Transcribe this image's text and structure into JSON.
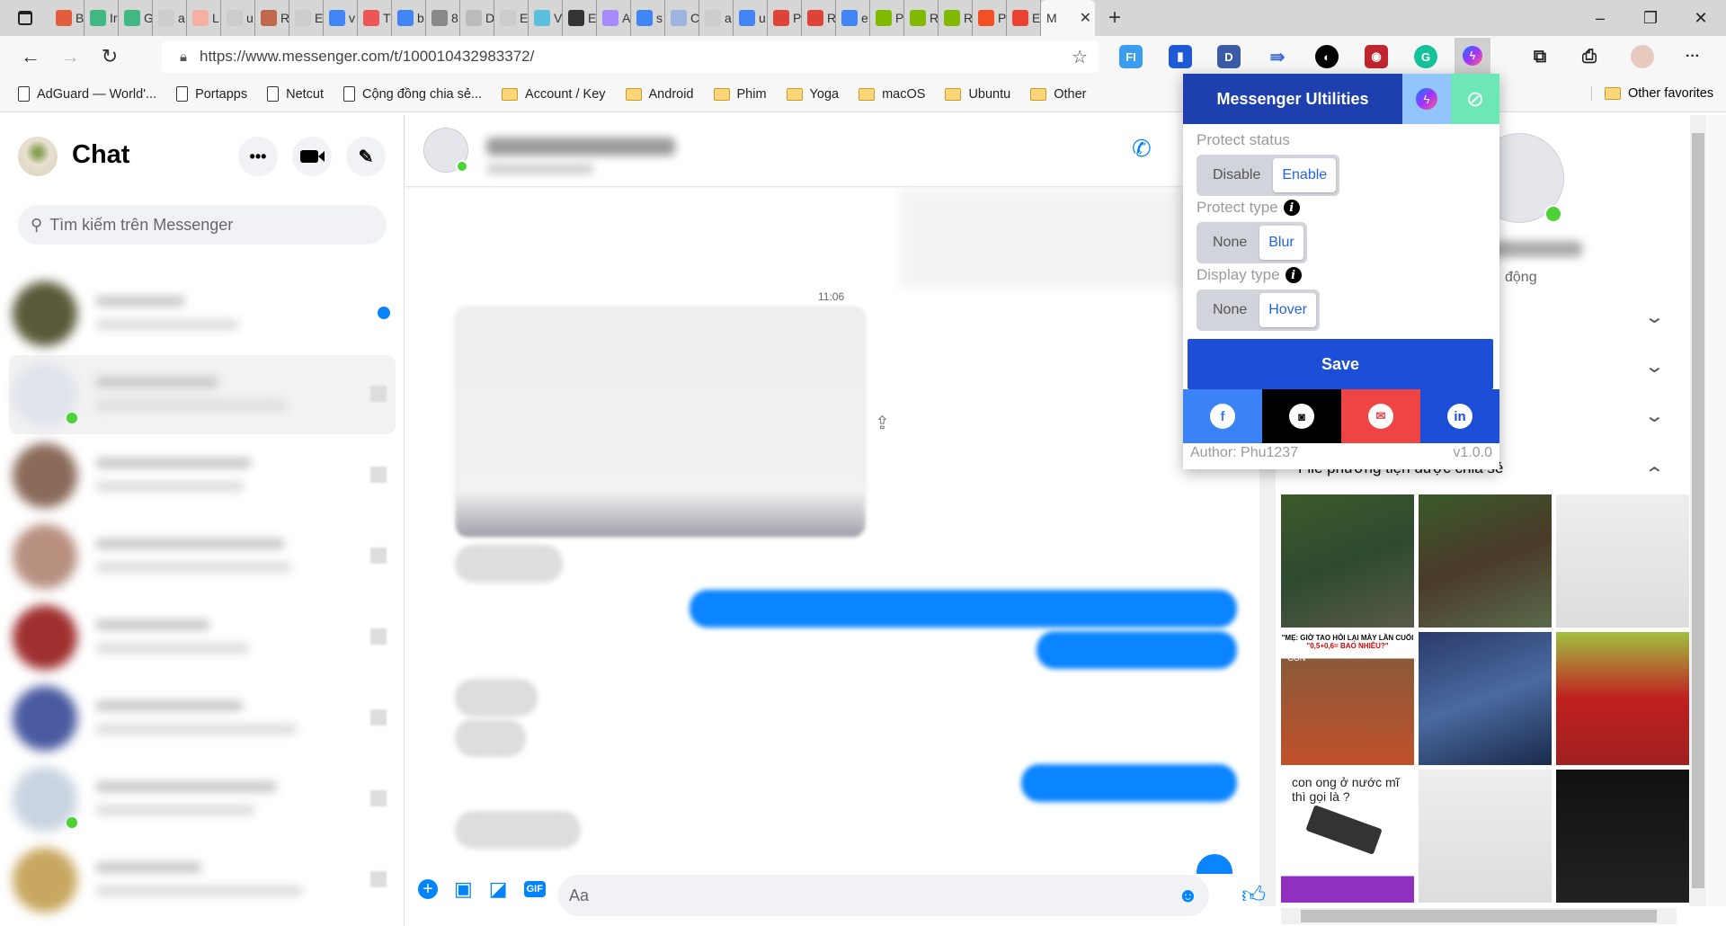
{
  "browser": {
    "tabs": [
      "B",
      "Ir",
      "G",
      "a",
      "L",
      "u",
      "R",
      "E",
      "v",
      "Tı",
      "b",
      "8",
      "D",
      "E",
      "V",
      "E",
      "A",
      "s",
      "C",
      "a",
      "u",
      "P",
      "R",
      "e",
      "P",
      "R",
      "R",
      "P",
      "E"
    ],
    "active_tab": "M",
    "new_tab": "+",
    "window": {
      "minimize": "–",
      "maximize": "❐",
      "close": "✕"
    },
    "url": "https://www.messenger.com/t/100010432983372/",
    "more": "···",
    "bookmarks": [
      {
        "label": "AdGuard — World'...",
        "type": "page"
      },
      {
        "label": "Portapps",
        "type": "page"
      },
      {
        "label": "Netcut",
        "type": "page"
      },
      {
        "label": "Cộng đồng chia sẻ...",
        "type": "page"
      },
      {
        "label": "Account / Key",
        "type": "folder"
      },
      {
        "label": "Android",
        "type": "folder"
      },
      {
        "label": "Phim",
        "type": "folder"
      },
      {
        "label": "Yoga",
        "type": "folder"
      },
      {
        "label": "macOS",
        "type": "folder"
      },
      {
        "label": "Ubuntu",
        "type": "folder"
      },
      {
        "label": "Other",
        "type": "folder"
      }
    ],
    "other_favorites": "Other favorites"
  },
  "sidebar": {
    "title": "Chat",
    "search_placeholder": "Tìm kiếm trên Messenger",
    "more": "•••"
  },
  "conversation": {
    "timestamp": "11:06",
    "composer_placeholder": "Aa",
    "gif": "GIF"
  },
  "right_panel": {
    "status_suffix": "động",
    "media_section": "File phương tiện được chia sẻ",
    "media_captions": [
      "\"MẸ: GIỜ TAO HỎI LẠI MÀY LẦN CUỐI",
      "\"0,5+0,6= BAO NHIÊU?\"",
      "\"CON",
      "con ong ở nước mĩ thì gọi là ?"
    ]
  },
  "popup": {
    "title": "Messenger Ultilities",
    "protect_status": {
      "label": "Protect status",
      "options": [
        "Disable",
        "Enable"
      ],
      "selected": "Enable"
    },
    "protect_type": {
      "label": "Protect type",
      "options": [
        "None",
        "Blur"
      ],
      "selected": "Blur"
    },
    "display_type": {
      "label": "Display type",
      "options": [
        "None",
        "Hover"
      ],
      "selected": "Hover"
    },
    "save": "Save",
    "author": "Author: Phu1237",
    "version": "v1.0.0",
    "colors": {
      "header": "#1e40af",
      "messenger_bg": "#93c5fd",
      "eye_bg": "#6ee7b7",
      "save": "#1d4ed8",
      "facebook": "#3b82f6",
      "github": "#000000",
      "email": "#ef4444",
      "linkedin": "#1d4ed8"
    }
  }
}
